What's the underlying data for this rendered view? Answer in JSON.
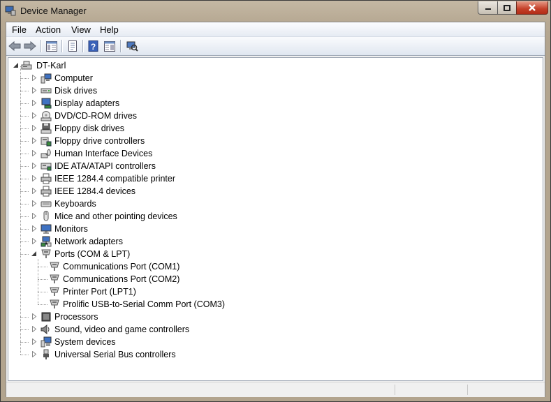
{
  "window": {
    "title": "Device Manager"
  },
  "menu": [
    "File",
    "Action",
    "View",
    "Help"
  ],
  "toolbar": [
    "back-icon",
    "forward-icon",
    "console-tree-icon",
    "properties-icon",
    "help-icon",
    "show-hide-icon",
    "scan-hardware-icon"
  ],
  "tree": {
    "root": "DT-Karl",
    "categories": [
      {
        "label": "Computer",
        "icon": "computer-icon"
      },
      {
        "label": "Disk drives",
        "icon": "disk-drive-icon"
      },
      {
        "label": "Display adapters",
        "icon": "display-adapter-icon"
      },
      {
        "label": "DVD/CD-ROM drives",
        "icon": "dvd-drive-icon"
      },
      {
        "label": "Floppy disk drives",
        "icon": "floppy-drive-icon"
      },
      {
        "label": "Floppy drive controllers",
        "icon": "floppy-controller-icon"
      },
      {
        "label": "Human Interface Devices",
        "icon": "hid-icon"
      },
      {
        "label": "IDE ATA/ATAPI controllers",
        "icon": "ide-controller-icon"
      },
      {
        "label": "IEEE 1284.4 compatible printer",
        "icon": "printer-icon"
      },
      {
        "label": "IEEE 1284.4 devices",
        "icon": "printer-icon"
      },
      {
        "label": "Keyboards",
        "icon": "keyboard-icon"
      },
      {
        "label": "Mice and other pointing devices",
        "icon": "mouse-icon"
      },
      {
        "label": "Monitors",
        "icon": "monitor-icon"
      },
      {
        "label": "Network adapters",
        "icon": "network-adapter-icon"
      },
      {
        "label": "Ports (COM & LPT)",
        "icon": "port-icon",
        "expanded": true,
        "children": [
          "Communications Port (COM1)",
          "Communications Port (COM2)",
          "Printer Port (LPT1)",
          "Prolific USB-to-Serial Comm Port (COM3)"
        ]
      },
      {
        "label": "Processors",
        "icon": "processor-icon"
      },
      {
        "label": "Sound, video and game controllers",
        "icon": "sound-icon"
      },
      {
        "label": "System devices",
        "icon": "system-devices-icon"
      },
      {
        "label": "Universal Serial Bus controllers",
        "icon": "usb-icon"
      }
    ]
  }
}
